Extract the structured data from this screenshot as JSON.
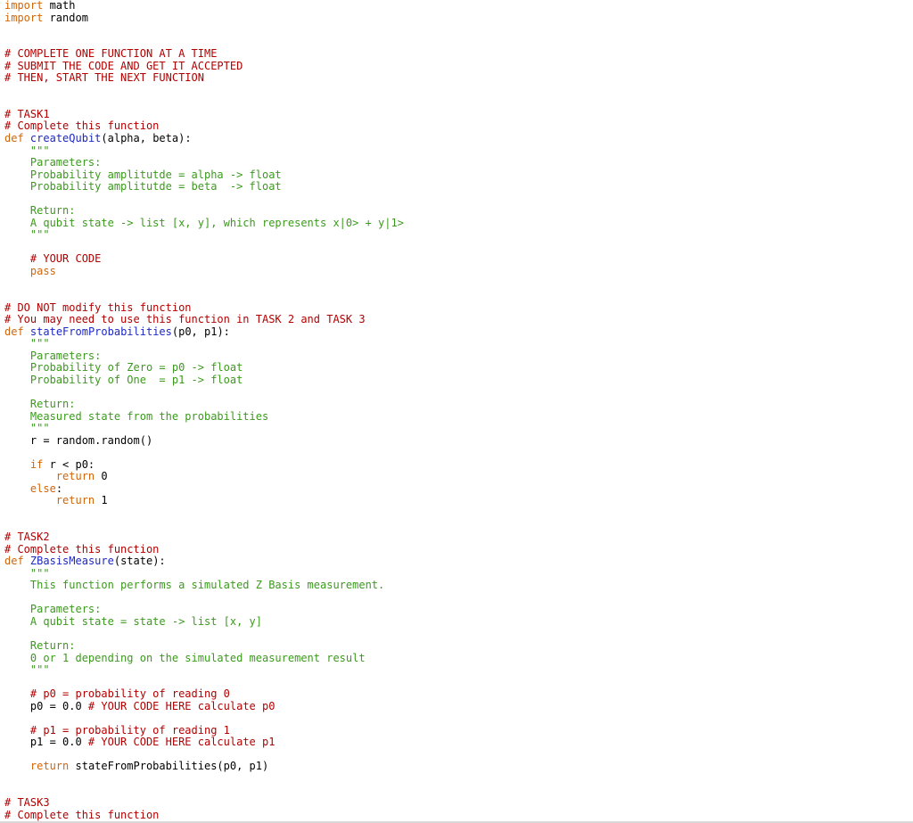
{
  "lines": [
    [
      {
        "t": "import",
        "c": "kw"
      },
      {
        "t": " math",
        "c": ""
      }
    ],
    [
      {
        "t": "import",
        "c": "kw"
      },
      {
        "t": " random",
        "c": ""
      }
    ],
    [],
    [],
    [
      {
        "t": "# COMPLETE ONE FUNCTION AT A TIME",
        "c": "comment"
      }
    ],
    [
      {
        "t": "# SUBMIT THE CODE AND GET IT ACCEPTED",
        "c": "comment"
      }
    ],
    [
      {
        "t": "# THEN, START THE NEXT FUNCTION",
        "c": "comment"
      }
    ],
    [],
    [],
    [
      {
        "t": "# TASK1",
        "c": "comment"
      }
    ],
    [
      {
        "t": "# Complete this function",
        "c": "comment"
      }
    ],
    [
      {
        "t": "def",
        "c": "kw"
      },
      {
        "t": " ",
        "c": ""
      },
      {
        "t": "createQubit",
        "c": "fn"
      },
      {
        "t": "(alpha, beta):",
        "c": ""
      }
    ],
    [
      {
        "t": "    \"\"\"",
        "c": "doc"
      }
    ],
    [
      {
        "t": "    Parameters:",
        "c": "doc"
      }
    ],
    [
      {
        "t": "    Probability amplitutde = alpha -> float",
        "c": "doc"
      }
    ],
    [
      {
        "t": "    Probability amplitutde = beta  -> float",
        "c": "doc"
      }
    ],
    [],
    [
      {
        "t": "    Return:",
        "c": "doc"
      }
    ],
    [
      {
        "t": "    A qubit state -> list [x, y], which represents x|0> + y|1>",
        "c": "doc"
      }
    ],
    [
      {
        "t": "    \"\"\"",
        "c": "doc"
      }
    ],
    [],
    [
      {
        "t": "    # YOUR CODE",
        "c": "comment"
      }
    ],
    [
      {
        "t": "    ",
        "c": ""
      },
      {
        "t": "pass",
        "c": "kw"
      }
    ],
    [],
    [],
    [
      {
        "t": "# DO NOT modify this function",
        "c": "comment"
      }
    ],
    [
      {
        "t": "# You may need to use this function in TASK 2 and TASK 3",
        "c": "comment"
      }
    ],
    [
      {
        "t": "def",
        "c": "kw"
      },
      {
        "t": " ",
        "c": ""
      },
      {
        "t": "stateFromProbabilities",
        "c": "fn"
      },
      {
        "t": "(p0, p1):",
        "c": ""
      }
    ],
    [
      {
        "t": "    \"\"\"",
        "c": "doc"
      }
    ],
    [
      {
        "t": "    Parameters:",
        "c": "doc"
      }
    ],
    [
      {
        "t": "    Probability of Zero = p0 -> float",
        "c": "doc"
      }
    ],
    [
      {
        "t": "    Probability of One  = p1 -> float",
        "c": "doc"
      }
    ],
    [],
    [
      {
        "t": "    Return:",
        "c": "doc"
      }
    ],
    [
      {
        "t": "    Measured state from the probabilities",
        "c": "doc"
      }
    ],
    [
      {
        "t": "    \"\"\"",
        "c": "doc"
      }
    ],
    [
      {
        "t": "    r = random.random()",
        "c": ""
      }
    ],
    [],
    [
      {
        "t": "    ",
        "c": ""
      },
      {
        "t": "if",
        "c": "kw"
      },
      {
        "t": " r < p0:",
        "c": ""
      }
    ],
    [
      {
        "t": "        ",
        "c": ""
      },
      {
        "t": "return",
        "c": "kw"
      },
      {
        "t": " 0",
        "c": ""
      }
    ],
    [
      {
        "t": "    ",
        "c": ""
      },
      {
        "t": "else",
        "c": "kw"
      },
      {
        "t": ":",
        "c": ""
      }
    ],
    [
      {
        "t": "        ",
        "c": ""
      },
      {
        "t": "return",
        "c": "kw"
      },
      {
        "t": " 1",
        "c": ""
      }
    ],
    [],
    [],
    [
      {
        "t": "# TASK2",
        "c": "comment"
      }
    ],
    [
      {
        "t": "# Complete this function",
        "c": "comment"
      }
    ],
    [
      {
        "t": "def",
        "c": "kw"
      },
      {
        "t": " ",
        "c": ""
      },
      {
        "t": "ZBasisMeasure",
        "c": "fn"
      },
      {
        "t": "(state):",
        "c": ""
      }
    ],
    [
      {
        "t": "    \"\"\"",
        "c": "doc"
      }
    ],
    [
      {
        "t": "    This function performs a simulated Z Basis measurement.",
        "c": "doc"
      }
    ],
    [],
    [
      {
        "t": "    Parameters:",
        "c": "doc"
      }
    ],
    [
      {
        "t": "    A qubit state = state -> list [x, y]",
        "c": "doc"
      }
    ],
    [],
    [
      {
        "t": "    Return:",
        "c": "doc"
      }
    ],
    [
      {
        "t": "    0 or 1 depending on the simulated measurement result",
        "c": "doc"
      }
    ],
    [
      {
        "t": "    \"\"\"",
        "c": "doc"
      }
    ],
    [],
    [
      {
        "t": "    # p0 = probability of reading 0",
        "c": "comment"
      }
    ],
    [
      {
        "t": "    p0 = 0.0 ",
        "c": ""
      },
      {
        "t": "# YOUR CODE HERE calculate p0",
        "c": "comment"
      }
    ],
    [],
    [
      {
        "t": "    # p1 = probability of reading 1",
        "c": "comment"
      }
    ],
    [
      {
        "t": "    p1 = 0.0 ",
        "c": ""
      },
      {
        "t": "# YOUR CODE HERE calculate p1",
        "c": "comment"
      }
    ],
    [],
    [
      {
        "t": "    ",
        "c": ""
      },
      {
        "t": "return",
        "c": "kw"
      },
      {
        "t": " stateFromProbabilities(p0, p1)",
        "c": ""
      }
    ],
    [],
    [],
    [
      {
        "t": "# TASK3",
        "c": "comment"
      }
    ],
    [
      {
        "t": "# Complete this function",
        "c": "comment"
      }
    ]
  ]
}
